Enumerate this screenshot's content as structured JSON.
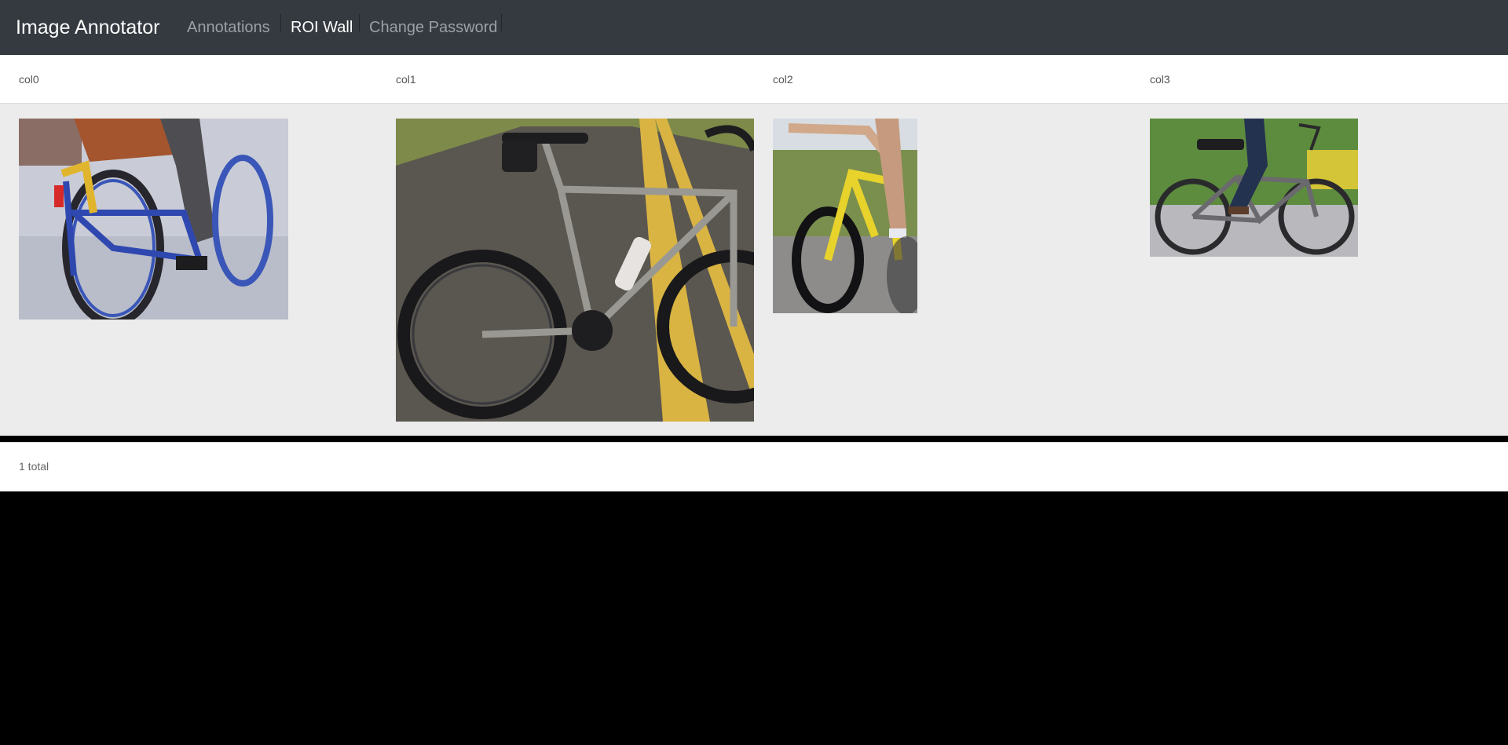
{
  "navbar": {
    "brand": "Image Annotator",
    "links": [
      {
        "label": "Annotations",
        "active": false
      },
      {
        "label": "ROI Wall",
        "active": true
      },
      {
        "label": "Change Password",
        "active": false
      }
    ]
  },
  "wall": {
    "columns": [
      "col0",
      "col1",
      "col2",
      "col3"
    ],
    "images": [
      {
        "column": "col0",
        "subject": "cyclist-blue-bike-photo"
      },
      {
        "column": "col1",
        "subject": "titanium-road-bike-photo"
      },
      {
        "column": "col2",
        "subject": "yellow-road-bike-photo"
      },
      {
        "column": "col3",
        "subject": "city-ebike-photo"
      }
    ]
  },
  "pagination": {
    "total_text": "1 total"
  },
  "colors": {
    "navbar_bg": "#343a40",
    "panel_bg": "#ececec",
    "page_bg": "#000000"
  }
}
